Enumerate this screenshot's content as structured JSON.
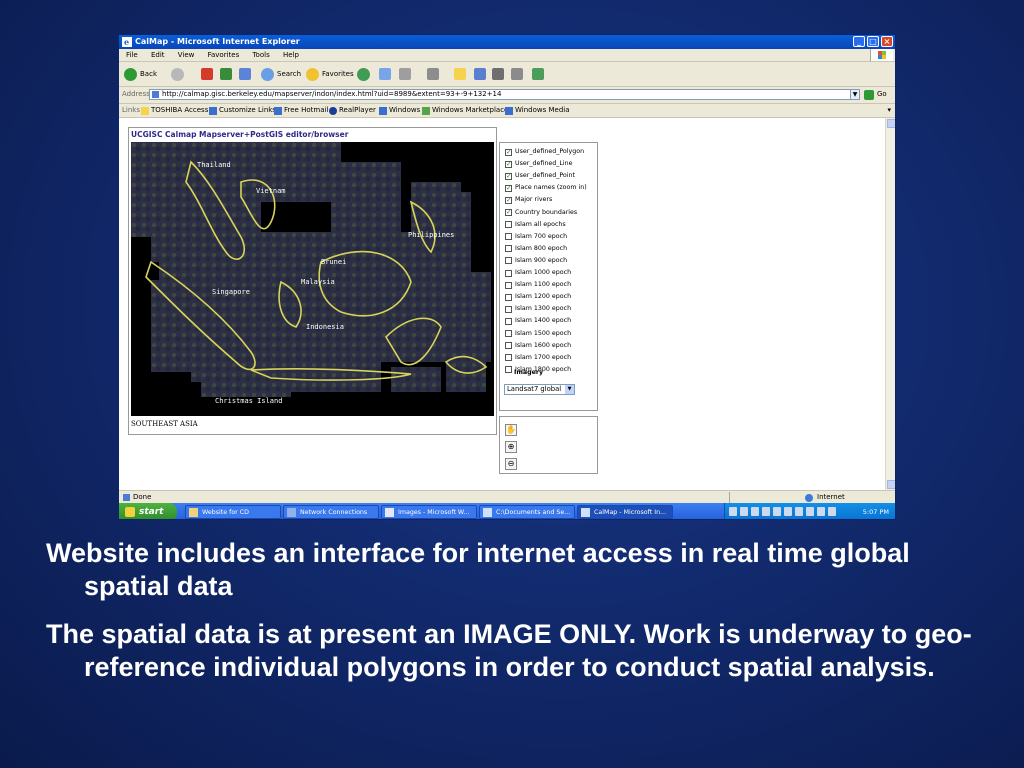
{
  "window": {
    "title": "CalMap - Microsoft Internet Explorer",
    "icon": "ie-icon"
  },
  "menu": [
    "File",
    "Edit",
    "View",
    "Favorites",
    "Tools",
    "Help"
  ],
  "toolbar": {
    "back_label": "Back",
    "search_label": "Search",
    "favorites_label": "Favorites"
  },
  "address": {
    "label": "Address",
    "url": "http://calmap.gisc.berkeley.edu/mapserver/indon/index.html?uid=8989&extent=93+-9+132+14",
    "go_label": "Go"
  },
  "links": {
    "label": "Links",
    "items": [
      "TOSHIBA Access",
      "Customize Links",
      "Free Hotmail",
      "RealPlayer",
      "Windows",
      "Windows Marketplace",
      "Windows Media"
    ]
  },
  "page": {
    "map_title": "UCGISC Calmap Mapserver+PostGIS editor/browser",
    "region": "SOUTHEAST ASIA",
    "map_labels": [
      "Thailand",
      "Vietnam",
      "Philippines",
      "Brunei",
      "Malaysia",
      "Singapore",
      "Indonesia",
      "Christmas Island"
    ],
    "layers": [
      {
        "label": "User_defined_Polygon",
        "checked": true
      },
      {
        "label": "User_defined_Line",
        "checked": true
      },
      {
        "label": "User_defined_Point",
        "checked": true
      },
      {
        "label": "Place names (zoom in)",
        "checked": true
      },
      {
        "label": "Major rivers",
        "checked": true
      },
      {
        "label": "Country boundaries",
        "checked": true
      },
      {
        "label": "Islam all epochs",
        "checked": false
      },
      {
        "label": "Islam 700 epoch",
        "checked": false
      },
      {
        "label": "Islam 800 epoch",
        "checked": false
      },
      {
        "label": "Islam 900 epoch",
        "checked": false
      },
      {
        "label": "Islam 1000 epoch",
        "checked": false
      },
      {
        "label": "Islam 1100 epoch",
        "checked": false
      },
      {
        "label": "Islam 1200 epoch",
        "checked": false
      },
      {
        "label": "Islam 1300 epoch",
        "checked": false
      },
      {
        "label": "Islam 1400 epoch",
        "checked": false
      },
      {
        "label": "Islam 1500 epoch",
        "checked": false
      },
      {
        "label": "Islam 1600 epoch",
        "checked": false
      },
      {
        "label": "Islam 1700 epoch",
        "checked": false
      },
      {
        "label": "Islam 1800 epoch",
        "checked": false
      }
    ],
    "imagery_label": "Imagery",
    "imagery_selected": "Landsat7 global",
    "tools": [
      "pan-hand-icon",
      "zoom-in-icon",
      "zoom-out-icon"
    ]
  },
  "status": {
    "left": "Done",
    "zone": "Internet"
  },
  "taskbar": {
    "start_label": "start",
    "tasks": [
      {
        "label": "Website for CD",
        "active": false
      },
      {
        "label": "Network Connections",
        "active": false
      },
      {
        "label": "Images - Microsoft W...",
        "active": false
      },
      {
        "label": "C:\\Documents and Se...",
        "active": false
      },
      {
        "label": "CalMap - Microsoft In...",
        "active": true
      }
    ],
    "clock": "5:07 PM"
  },
  "slide": {
    "bullets": [
      "Website includes an interface for internet access in real time global spatial data",
      "The spatial data is at present an IMAGE ONLY.  Work is underway to geo-reference individual polygons in order to conduct spatial analysis."
    ]
  },
  "colors": {
    "slide_background": "#122a6e",
    "xp_titlebar": "#0a5fd8",
    "map_outline": "#d8d35a",
    "link_text": "#2e2a8c"
  }
}
